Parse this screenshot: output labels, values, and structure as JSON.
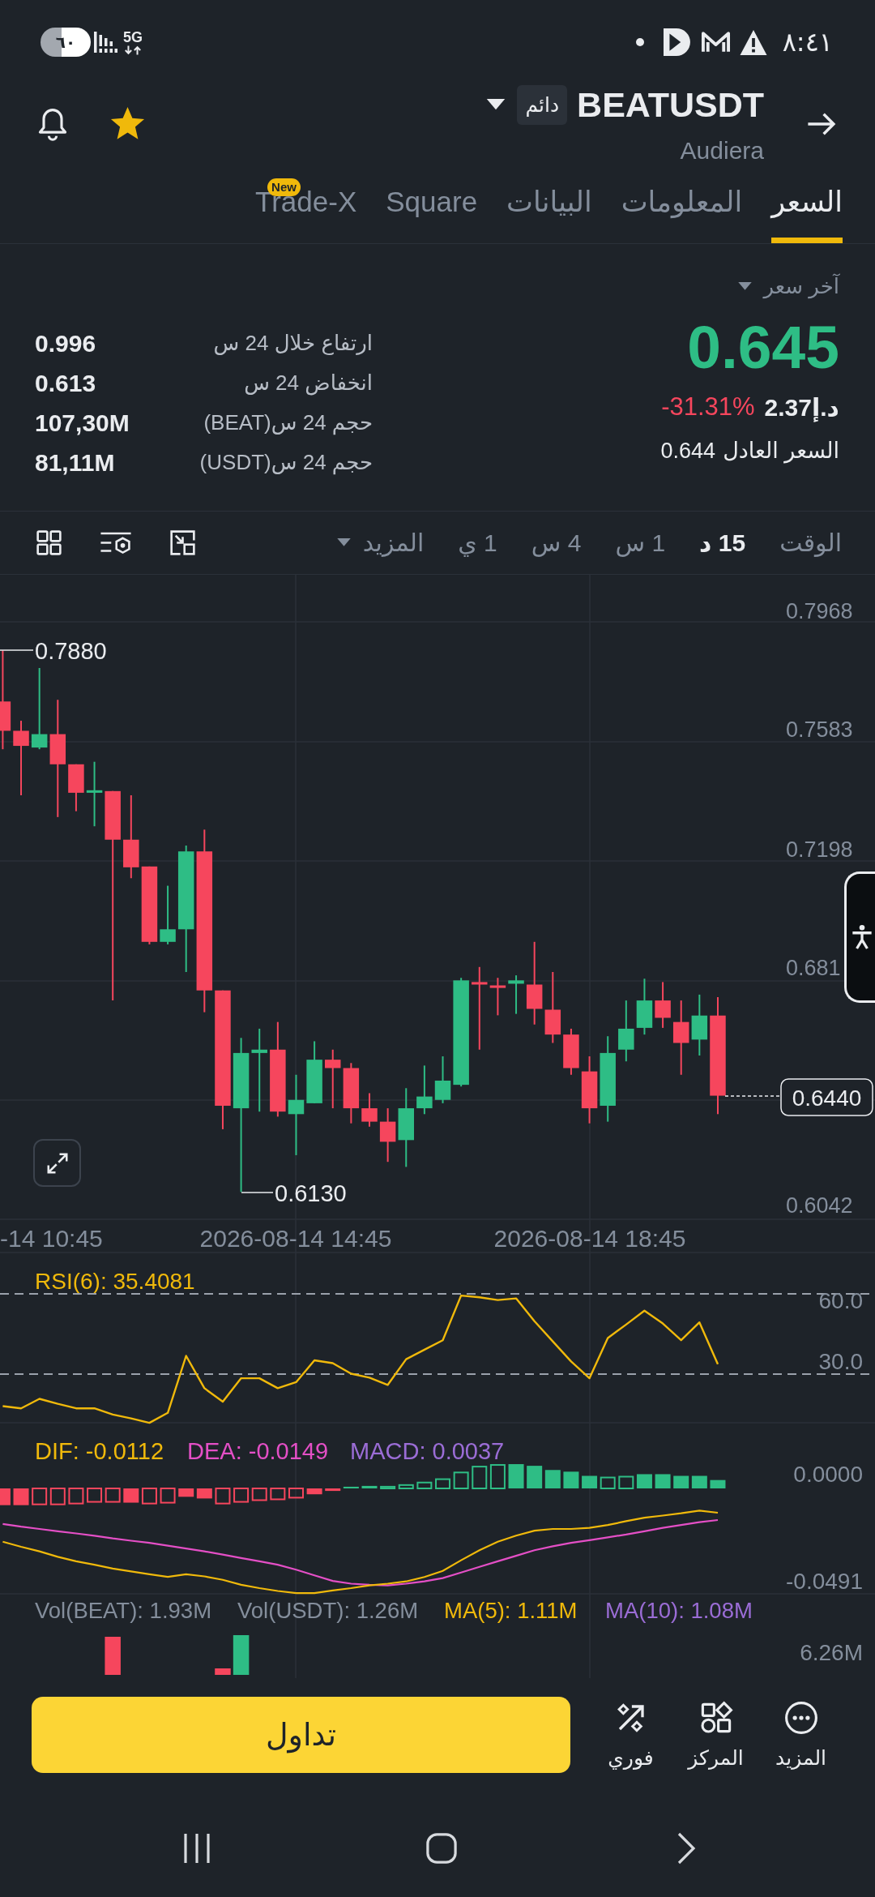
{
  "status_bar": {
    "battery": "٦٠",
    "network": "5G",
    "time": "٨:٤١"
  },
  "header": {
    "symbol": "BEATUSDT",
    "badge": "دائم",
    "name": "Audiera"
  },
  "tabs": [
    {
      "label": "السعر",
      "selected": true
    },
    {
      "label": "المعلومات",
      "selected": false
    },
    {
      "label": "البيانات",
      "selected": false
    },
    {
      "label": "Square",
      "selected": false
    },
    {
      "badge": "New",
      "label": "Trade-X",
      "selected": false
    }
  ],
  "price": {
    "caption": "آخر سعر",
    "last": "0.645",
    "fiat": "د.إ2.37",
    "change": "-31.31%",
    "fair_label": "السعر العادل",
    "fair_value": "0.644"
  },
  "stats": [
    {
      "label": "ارتفاع خلال 24 س",
      "value": "0.996"
    },
    {
      "label": "انخفاض 24 س",
      "value": "0.613"
    },
    {
      "label": "حجم 24 س(BEAT)",
      "value": "107,30M"
    },
    {
      "label": "حجم 24 س(USDT)",
      "value": "81,11M"
    }
  ],
  "intervals": {
    "label": "الوقت",
    "items": [
      {
        "label": "15 د",
        "selected": true
      },
      {
        "label": "1 س",
        "selected": false
      },
      {
        "label": "4 س",
        "selected": false
      },
      {
        "label": "1 ي",
        "selected": false
      }
    ],
    "more": "المزيد"
  },
  "chart": {
    "price_ticks": [
      "0.7968",
      "0.7583",
      "0.7198",
      "0.681",
      "0.6042"
    ],
    "high_label": "0.7880",
    "low_label": "0.6130",
    "last_price": "0.6440",
    "time_labels": [
      "2026-08-14 18:45",
      "2026-08-14 14:45",
      "-14 10:45"
    ]
  },
  "rsi": {
    "legend": "RSI(6): 35.4081",
    "ticks": [
      "60.0",
      "30.0"
    ]
  },
  "macd": {
    "legends": [
      {
        "text": "MACD: 0.0037",
        "color": "#9b6dd6"
      },
      {
        "text": "DEA: -0.0149",
        "color": "#e44fc6"
      },
      {
        "text": "DIF: -0.0112",
        "color": "#f0b90b"
      }
    ],
    "ticks": [
      "0.0000",
      "-0.0491"
    ]
  },
  "volume": {
    "legends": [
      {
        "text": "MA(10): 1.08M",
        "color": "#9b6dd6"
      },
      {
        "text": "MA(5): 1.11M",
        "color": "#f0b90b"
      },
      {
        "text": "Vol(USDT): 1.26M",
        "color": "#848e9c"
      },
      {
        "text": "Vol(BEAT): 1.93M",
        "color": "#848e9c"
      }
    ],
    "tick": "6.26M"
  },
  "actions": {
    "trade": "تداول",
    "items": [
      {
        "kind": "more",
        "label": "المزيد"
      },
      {
        "kind": "hub",
        "label": "المركز"
      },
      {
        "kind": "instant",
        "label": "فوري"
      }
    ]
  }
}
